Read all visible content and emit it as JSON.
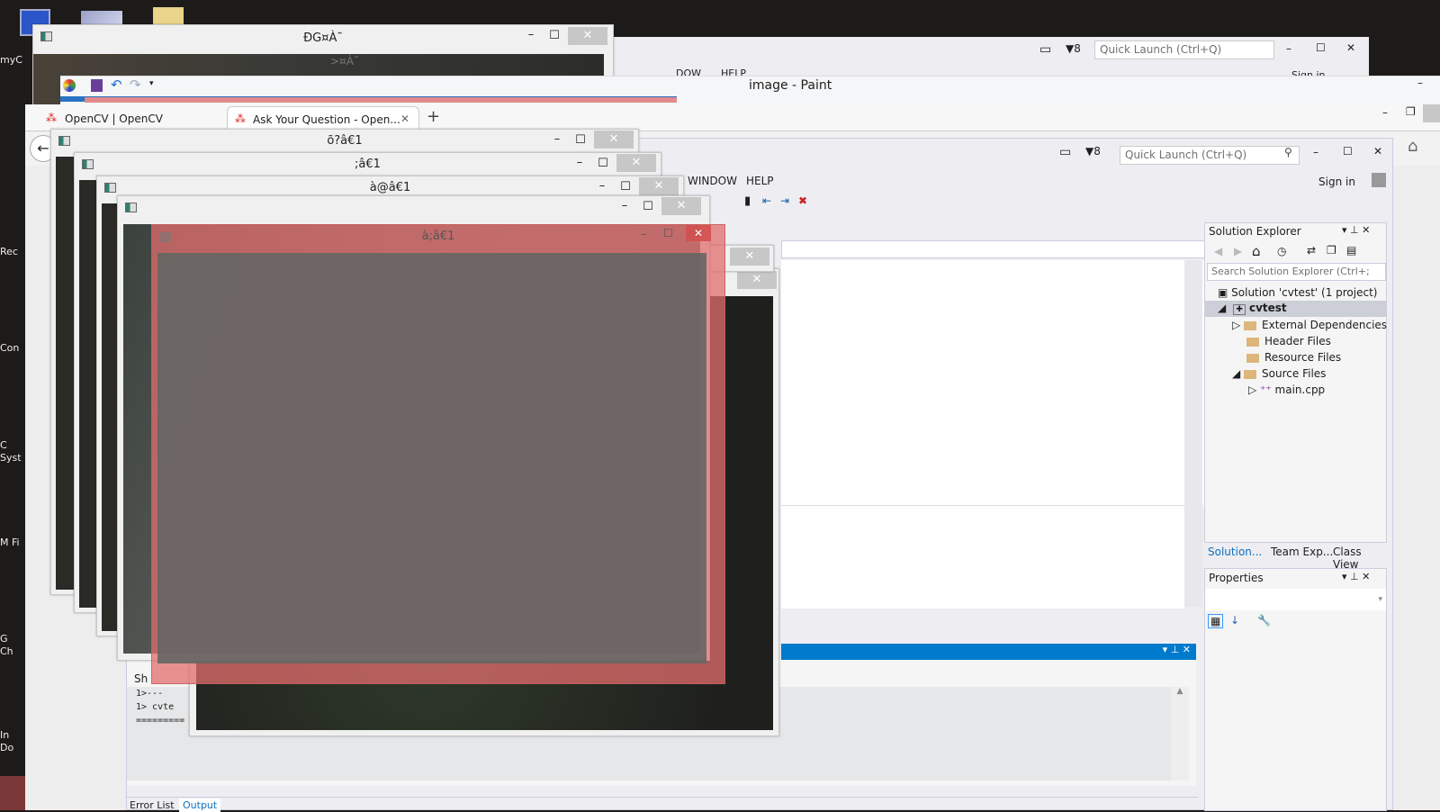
{
  "desktop": {
    "icons": [
      "myC",
      "Rec",
      "Con",
      "C Syst",
      "M Fi",
      "G Ch",
      "In Do"
    ]
  },
  "back_vs": {
    "filter_count": "8",
    "quick_launch_placeholder": "Quick Launch (Ctrl+Q)",
    "menu_partial": [
      "DOW",
      "HELP"
    ],
    "sign_in_partial": "Sign in"
  },
  "top_window": {
    "title": "ĐG¤À˜",
    "behind_title": ">¤À˜"
  },
  "paint": {
    "title": "image - Paint"
  },
  "browser": {
    "tabs": [
      {
        "label": "OpenCV | OpenCV",
        "active": false
      },
      {
        "label": "Ask Your Question - Open...",
        "active": true
      }
    ],
    "new_tab": "+"
  },
  "vs": {
    "filter_count": "8",
    "quick_launch_placeholder": "Quick Launch (Ctrl+Q)",
    "menu": [
      "WINDOW",
      "HELP"
    ],
    "sign_in": "Sign in",
    "solution_explorer": {
      "title": "Solution Explorer",
      "search_placeholder": "Search Solution Explorer (Ctrl+;",
      "tree": {
        "solution": "Solution 'cvtest' (1 project)",
        "project": "cvtest",
        "items": [
          "External Dependencies",
          "Header Files",
          "Resource Files",
          "Source Files"
        ],
        "file": "main.cpp"
      },
      "tabs": [
        "Solution...",
        "Team Exp...",
        "Class View"
      ]
    },
    "properties": {
      "title": "Properties"
    },
    "output": {
      "show_label": "Sh",
      "lines": [
        "1>---",
        "1>  cvte",
        "========="
      ]
    },
    "bottom_tabs": [
      "Error List",
      "Output"
    ],
    "accent": "#007acc"
  },
  "cv_windows": [
    {
      "title": "õ?â€1"
    },
    {
      "title": ";â€1"
    },
    {
      "title": "à@â€1"
    },
    {
      "title": ""
    },
    {
      "title": "à;â€1"
    }
  ]
}
